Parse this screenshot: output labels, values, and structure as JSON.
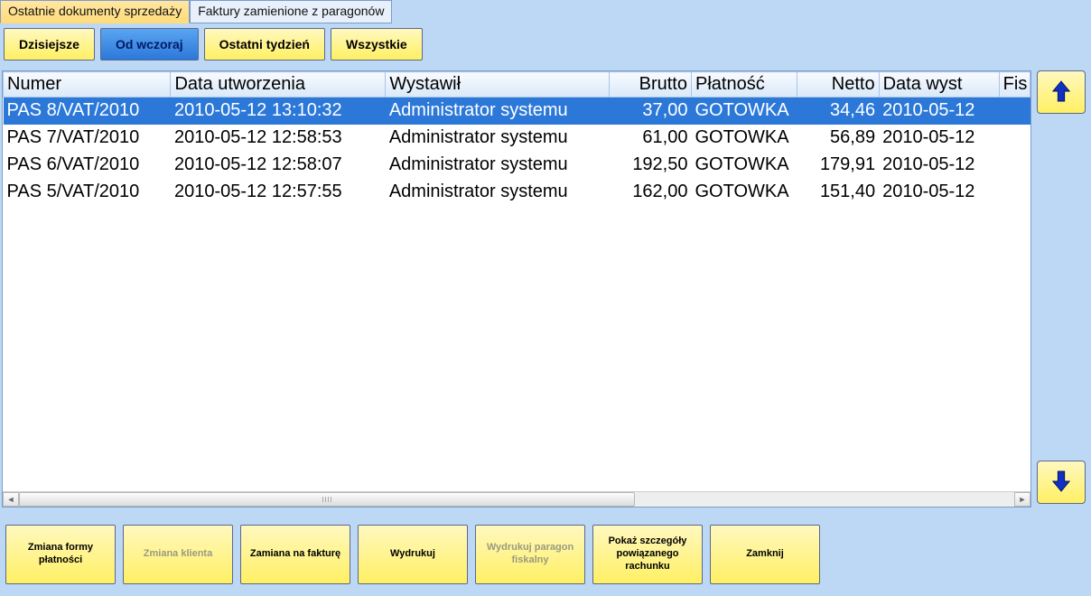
{
  "tabs": [
    {
      "label": "Ostatnie dokumenty sprzedaży",
      "active": true
    },
    {
      "label": "Faktury zamienione z paragonów",
      "active": false
    }
  ],
  "filters": [
    {
      "label": "Dzisiejsze",
      "style": "yellow"
    },
    {
      "label": "Od wczoraj",
      "style": "blue"
    },
    {
      "label": "Ostatni tydzień",
      "style": "yellow"
    },
    {
      "label": "Wszystkie",
      "style": "yellow"
    }
  ],
  "columns": {
    "numer": "Numer",
    "data": "Data utworzenia",
    "wystawil": "Wystawił",
    "brutto": "Brutto",
    "platnosc": "Płatność",
    "netto": "Netto",
    "datawyst": "Data wyst",
    "fis": "Fis"
  },
  "rows": [
    {
      "numer": "PAS 8/VAT/2010",
      "data": "2010-05-12 13:10:32",
      "wystawil": "Administrator systemu",
      "brutto": "37,00",
      "platnosc": "GOTOWKA",
      "netto": "34,46",
      "datawyst": "2010-05-12",
      "selected": true
    },
    {
      "numer": "PAS 7/VAT/2010",
      "data": "2010-05-12 12:58:53",
      "wystawil": "Administrator systemu",
      "brutto": "61,00",
      "platnosc": "GOTOWKA",
      "netto": "56,89",
      "datawyst": "2010-05-12",
      "selected": false
    },
    {
      "numer": "PAS 6/VAT/2010",
      "data": "2010-05-12 12:58:07",
      "wystawil": "Administrator systemu",
      "brutto": "192,50",
      "platnosc": "GOTOWKA",
      "netto": "179,91",
      "datawyst": "2010-05-12",
      "selected": false
    },
    {
      "numer": "PAS 5/VAT/2010",
      "data": "2010-05-12 12:57:55",
      "wystawil": "Administrator systemu",
      "brutto": "162,00",
      "platnosc": "GOTOWKA",
      "netto": "151,40",
      "datawyst": "2010-05-12",
      "selected": false
    }
  ],
  "actions": [
    {
      "label": "Zmiana formy płatności",
      "disabled": false
    },
    {
      "label": "Zmiana klienta",
      "disabled": true
    },
    {
      "label": "Zamiana na fakturę",
      "disabled": false
    },
    {
      "label": "Wydrukuj",
      "disabled": false
    },
    {
      "label": "Wydrukuj paragon fiskalny",
      "disabled": true
    },
    {
      "label": "Pokaż szczegóły powiązanego rachunku",
      "disabled": false
    },
    {
      "label": "Zamknij",
      "disabled": false
    }
  ]
}
